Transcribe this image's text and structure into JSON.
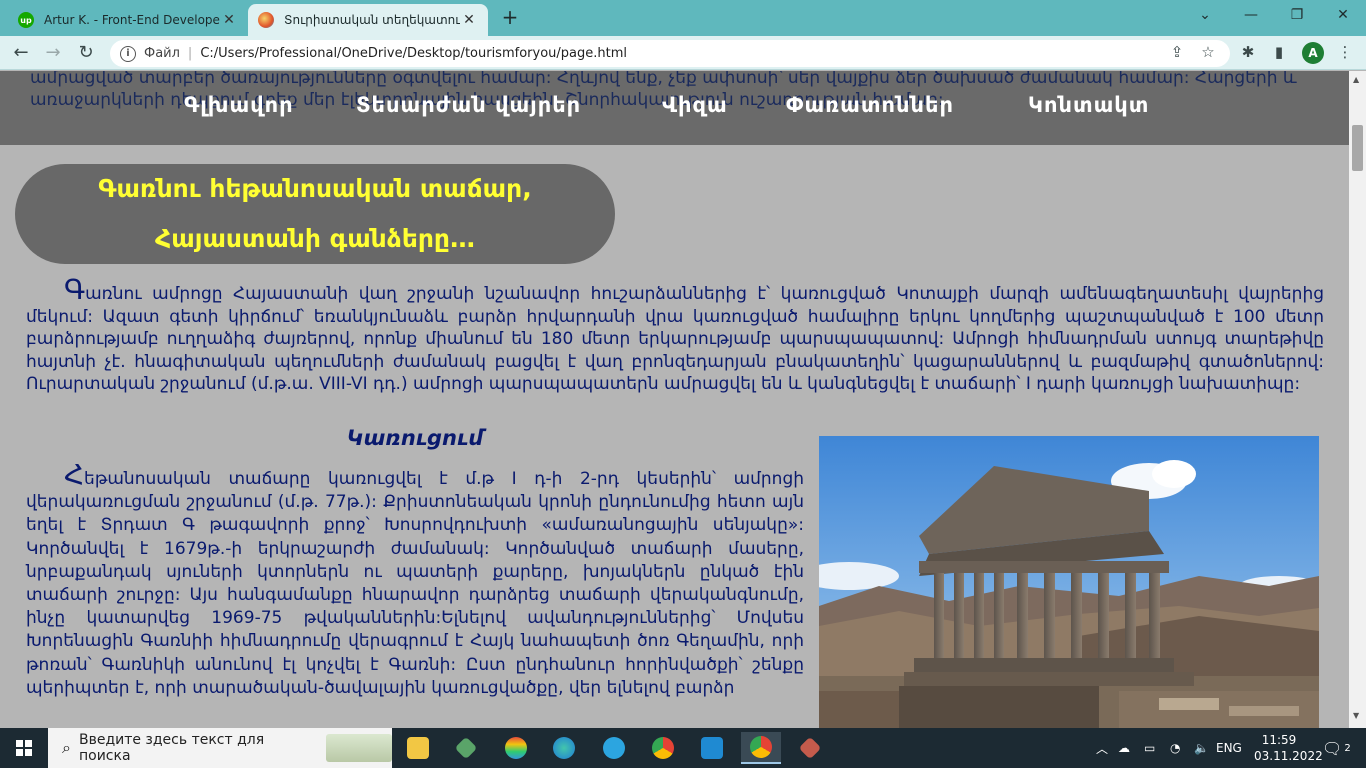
{
  "browser": {
    "tabs": [
      {
        "title": "Artur K. - Front-End Developer - ",
        "active": false,
        "favicon": "upwork-icon"
      },
      {
        "title": "Տուրիստական տեղեկատու",
        "active": true,
        "favicon": "globe-icon"
      }
    ],
    "new_tab_label": "+",
    "address_scheme": "Файл",
    "address_url": "C:/Users/Professional/OneDrive/Desktop/tourismforyou/page.html",
    "profile_initial": "A"
  },
  "page": {
    "behind_text": "ամրացված տարբեր ծառայությունները օգտվելու համար: Հղևյով ենք, չեք ափսոսի՝ սեր վայքիս ձեր ծախսած ժամանակ համար: Հարցերի և առաջարկների դեպքում գրեք մեր էլեկտրոնային հասցեին: Շնորհակալություն ուշադրության համար:",
    "nav": [
      "Գլխավոր",
      "Տեսարժան վայրեր",
      "Վիզա",
      "Փառատոններ",
      "Կոնտակտ"
    ],
    "title_line1": "Գառնու հեթանոսական տաճար,",
    "title_line2": "Հայաստանի գանձերը…",
    "para1_dropcap": "Գ",
    "para1_text": "առնու ամրոցը Հայաստանի վաղ շրջանի նշանավոր հուշարձաններից է՝ կառուցված Կոտայքի մարզի ամենագեղատեսիլ վայրերից մեկում: Ազատ գետի կիրճում՝ եռանկյունաձև բարձր հրվարդանի վրա կառուցված համալիրը երկու կողմերից պաշտպանված է 100 մետր բարձրությամբ ուղղաձիգ ժայռերով, որոնք միանում են 180 մետր երկարությամբ պարսպապատով: Ամրոցի հիմնադրման ստույգ տարեթիվը հայտնի չէ. հնագիտական պեղումների ժամանակ բացվել է վաղ բրոնզեդարյան բնակատեղին՝ կացարաններով և բազմաթիվ գտածոներով: Ուրարտական շրջանում (մ.թ.ա. VIII-VI դդ.) ամրոցի պարսպապատերն ամրացվել են և կանգնեցվել է տաճարի՝ I դարի կառույցի նախատիպը:",
    "section_heading": "Կառուցում",
    "para2_dropcap": "Հ",
    "para2_text": "եթանոսական տաճարը կառուցվել է մ.թ I դ-ի 2-րդ կեսերին՝ ամրոցի վերակառուցման շրջանում (մ.թ. 77թ.): Քրիստոնեական կրոնի ընդունումից հետո այն եղել է Տրդատ Գ թագավորի քրոջ՝ Խոսրովդուխտի «ամառանոցային սենյակը»: Կործանվել է 1679թ.-ի երկրաշարժի ժամանակ: Կործանված տաճարի մասերը, նրբաքանդակ սյուների կտորներն ու պատերի քարերը, խոյակներն ընկած էին տաճարի շուրջը: Այս հանգամանքը հնարավոր դարձրեց տաճարի վերականգնումը, ինչը կատարվեց 1969-75 թվականներին:Ելնելով ավանդություններից՝ Մովսես Խորենացին Գառնիի հիմնադրումը վերագրում է Հայկ նահապետի ծոռ Գեղամին, որի թոռան՝ Գառնիկի անունով էլ կոչվել է Գառնի: Ըստ ընդհանուր հորինվածքի՝ շենքը պերիպտեր է, որի տարածական-ծավալային կառուցվածքը, վեր ելնելով բարձր"
  },
  "taskbar": {
    "search_placeholder": "Введите здесь текст для поиска",
    "language": "ENG",
    "time": "11:59",
    "date": "03.11.2022",
    "notifications": "2"
  }
}
